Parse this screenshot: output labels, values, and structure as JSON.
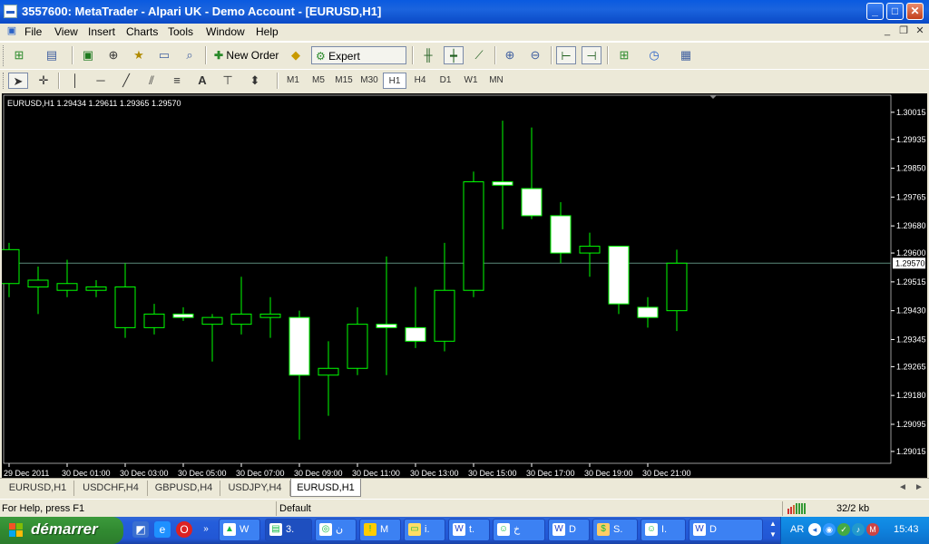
{
  "window": {
    "title": "3557600: MetaTrader - Alpari UK - Demo Account - [EURUSD,H1]",
    "minimize": "_",
    "maximize": "□",
    "close": "✕"
  },
  "menu": {
    "items": [
      "File",
      "View",
      "Insert",
      "Charts",
      "Tools",
      "Window",
      "Help"
    ],
    "mdi_minimize": "_",
    "mdi_restore": "❐",
    "mdi_close": "✕"
  },
  "toolbar": {
    "new_order_label": "New Order",
    "expert_advisors_label": "Expert Advisors"
  },
  "timeframes": {
    "items": [
      "M1",
      "M5",
      "M15",
      "M30",
      "H1",
      "H4",
      "D1",
      "W1",
      "MN"
    ],
    "selected": "H1"
  },
  "chart_data": {
    "type": "candlestick",
    "symbol_label": "EURUSD,H1  1.29434 1.29611 1.29365 1.29570",
    "current_price": "1.29570",
    "ylim": [
      1.2898,
      1.3006
    ],
    "y_ticks": [
      "1.30015",
      "1.29935",
      "1.29850",
      "1.29765",
      "1.29680",
      "1.29600",
      "1.29515",
      "1.29430",
      "1.29345",
      "1.29265",
      "1.29180",
      "1.29095",
      "1.29015"
    ],
    "x_ticks": [
      "29 Dec 2011",
      "30 Dec 01:00",
      "30 Dec 03:00",
      "30 Dec 05:00",
      "30 Dec 07:00",
      "30 Dec 09:00",
      "30 Dec 11:00",
      "30 Dec 13:00",
      "30 Dec 15:00",
      "30 Dec 17:00",
      "30 Dec 19:00",
      "30 Dec 21:00"
    ],
    "candles": [
      {
        "o": 1.2951,
        "h": 1.2963,
        "l": 1.2947,
        "c": 1.2961
      },
      {
        "o": 1.295,
        "h": 1.2956,
        "l": 1.2942,
        "c": 1.2952
      },
      {
        "o": 1.2949,
        "h": 1.2958,
        "l": 1.2947,
        "c": 1.2951
      },
      {
        "o": 1.2949,
        "h": 1.2952,
        "l": 1.2947,
        "c": 1.295
      },
      {
        "o": 1.2938,
        "h": 1.2957,
        "l": 1.2935,
        "c": 1.295
      },
      {
        "o": 1.2938,
        "h": 1.2945,
        "l": 1.2936,
        "c": 1.2942
      },
      {
        "o": 1.2942,
        "h": 1.2944,
        "l": 1.294,
        "c": 1.2941
      },
      {
        "o": 1.2939,
        "h": 1.2942,
        "l": 1.2928,
        "c": 1.2941
      },
      {
        "o": 1.2939,
        "h": 1.2953,
        "l": 1.2936,
        "c": 1.2942
      },
      {
        "o": 1.2941,
        "h": 1.2947,
        "l": 1.2935,
        "c": 1.2942
      },
      {
        "o": 1.2941,
        "h": 1.2943,
        "l": 1.2905,
        "c": 1.2924
      },
      {
        "o": 1.2924,
        "h": 1.2934,
        "l": 1.2912,
        "c": 1.2926
      },
      {
        "o": 1.2926,
        "h": 1.2944,
        "l": 1.2924,
        "c": 1.2939
      },
      {
        "o": 1.2939,
        "h": 1.2959,
        "l": 1.2924,
        "c": 1.2938
      },
      {
        "o": 1.2938,
        "h": 1.295,
        "l": 1.2932,
        "c": 1.2934
      },
      {
        "o": 1.2934,
        "h": 1.2963,
        "l": 1.2931,
        "c": 1.2949
      },
      {
        "o": 1.2949,
        "h": 1.2984,
        "l": 1.2947,
        "c": 1.2981
      },
      {
        "o": 1.2981,
        "h": 1.2999,
        "l": 1.2967,
        "c": 1.298
      },
      {
        "o": 1.2979,
        "h": 1.2997,
        "l": 1.297,
        "c": 1.2971
      },
      {
        "o": 1.2971,
        "h": 1.2975,
        "l": 1.2957,
        "c": 1.296
      },
      {
        "o": 1.296,
        "h": 1.2966,
        "l": 1.2953,
        "c": 1.2962
      },
      {
        "o": 1.2962,
        "h": 1.2962,
        "l": 1.2942,
        "c": 1.2945
      },
      {
        "o": 1.2944,
        "h": 1.2947,
        "l": 1.2938,
        "c": 1.2941
      },
      {
        "o": 1.2943,
        "h": 1.2961,
        "l": 1.2937,
        "c": 1.2957
      }
    ],
    "colors": {
      "background": "#000000",
      "candle_outline": "#00ff00",
      "bull_body": "#000000",
      "bear_body": "#ffffff",
      "price_line": "#5a8a7a",
      "axis_text": "#ffffff"
    }
  },
  "tabs": {
    "items": [
      "EURUSD,H1",
      "USDCHF,H4",
      "GBPUSD,H4",
      "USDJPY,H4",
      "EURUSD,H1"
    ],
    "active_index": 4,
    "prev": "◄",
    "next": "►"
  },
  "status": {
    "help": "For Help, press F1",
    "profile": "Default",
    "traffic": "32/2 kb"
  },
  "taskbar": {
    "start_label": "démarrer",
    "tasks": [
      {
        "label": "W",
        "icon": "w"
      },
      {
        "label": "3.",
        "icon": "m"
      },
      {
        "label": "ن",
        "icon": "g"
      },
      {
        "label": "M",
        "icon": "!"
      },
      {
        "label": "i.",
        "icon": "f"
      },
      {
        "label": "t.",
        "icon": "W"
      },
      {
        "label": "خ",
        "icon": "p"
      },
      {
        "label": "D",
        "icon": "W"
      },
      {
        "label": "S.",
        "icon": "s"
      },
      {
        "label": "I.",
        "icon": "p"
      },
      {
        "label": "D",
        "icon": "W"
      }
    ],
    "language": "AR",
    "clock": "15:43"
  }
}
